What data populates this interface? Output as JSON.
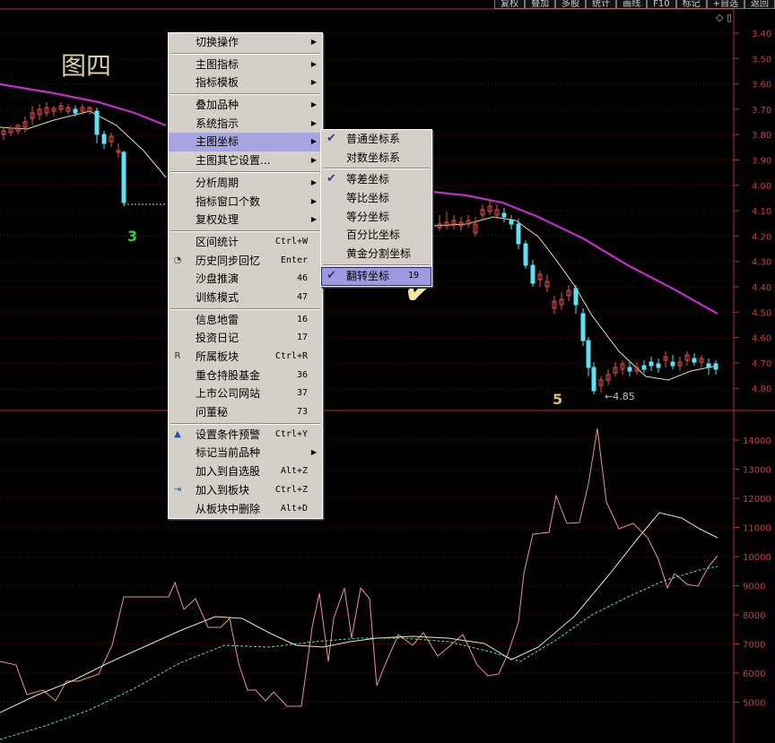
{
  "toolbar": [
    "复权",
    "叠加",
    "多股",
    "统计",
    "画线",
    "F10",
    "标记",
    "+自选",
    "返回"
  ],
  "title": "图四",
  "annotations": {
    "a3": "3",
    "a5": "5",
    "low": "←4.85",
    "check": "✔"
  },
  "price_axis": [
    "3.40",
    "3.50",
    "3.60",
    "3.70",
    "3.80",
    "3.90",
    "4.00",
    "4.10",
    "4.20",
    "4.30",
    "4.40",
    "4.50",
    "4.60",
    "4.70",
    "4.80"
  ],
  "volume_axis": [
    "14000",
    "13000",
    "12000",
    "11000",
    "10000",
    "9000",
    "8000",
    "7000",
    "6000",
    "5000"
  ],
  "context_menu": {
    "g1": [
      {
        "label": "切换操作",
        "submenu": true
      }
    ],
    "g2": [
      {
        "label": "主图指标",
        "submenu": true
      },
      {
        "label": "指标模板",
        "submenu": true
      }
    ],
    "g3": [
      {
        "label": "叠加品种",
        "submenu": true
      },
      {
        "label": "系统指示",
        "submenu": true
      },
      {
        "label": "主图坐标",
        "submenu": true,
        "selected": true
      },
      {
        "label": "主图其它设置...",
        "submenu": true
      }
    ],
    "g4": [
      {
        "label": "分析周期",
        "submenu": true
      },
      {
        "label": "指标窗口个数",
        "submenu": true
      },
      {
        "label": "复权处理",
        "submenu": true
      }
    ],
    "g5": [
      {
        "label": "区间统计",
        "shortcut": "Ctrl+W"
      },
      {
        "label": "历史同步回忆",
        "shortcut": "Enter",
        "icon": "clock-icon"
      },
      {
        "label": "沙盘推演",
        "shortcut": "46"
      },
      {
        "label": "训练模式",
        "shortcut": "47"
      }
    ],
    "g6": [
      {
        "label": "信息地雷",
        "shortcut": "16"
      },
      {
        "label": "投资日记",
        "shortcut": "17"
      },
      {
        "label": "所属板块",
        "shortcut": "Ctrl+R",
        "icon": "sector-icon"
      },
      {
        "label": "重仓持股基金",
        "shortcut": "36"
      },
      {
        "label": "上市公司网站",
        "shortcut": "37"
      },
      {
        "label": "问董秘",
        "shortcut": "73"
      }
    ],
    "g7": [
      {
        "label": "设置条件预警",
        "shortcut": "Ctrl+Y",
        "icon": "alert-icon"
      },
      {
        "label": "标记当前品种",
        "submenu": true
      },
      {
        "label": "加入到自选股",
        "shortcut": "Alt+Z"
      },
      {
        "label": "加入到板块",
        "shortcut": "Ctrl+Z",
        "icon": "add-sector-icon"
      },
      {
        "label": "从板块中删除",
        "shortcut": "Alt+D"
      }
    ]
  },
  "coord_submenu": {
    "g1": [
      {
        "label": "普通坐标系",
        "checked": true
      },
      {
        "label": "对数坐标系",
        "checked": false
      }
    ],
    "g2": [
      {
        "label": "等差坐标",
        "checked": true
      },
      {
        "label": "等比坐标",
        "checked": false
      },
      {
        "label": "等分坐标",
        "checked": false
      },
      {
        "label": "百分比坐标",
        "checked": false
      },
      {
        "label": "黄金分割坐标",
        "checked": false
      }
    ],
    "g3": [
      {
        "label": "翻转坐标",
        "checked": true,
        "shortcut": "19",
        "selected": true
      }
    ]
  },
  "colors": {
    "ma_slow": "#c030c8",
    "ma_fast": "#e8e0a0",
    "up": "#e05050",
    "down": "#60e0f0",
    "volume": "#f09090",
    "axis": "#b03030"
  }
}
